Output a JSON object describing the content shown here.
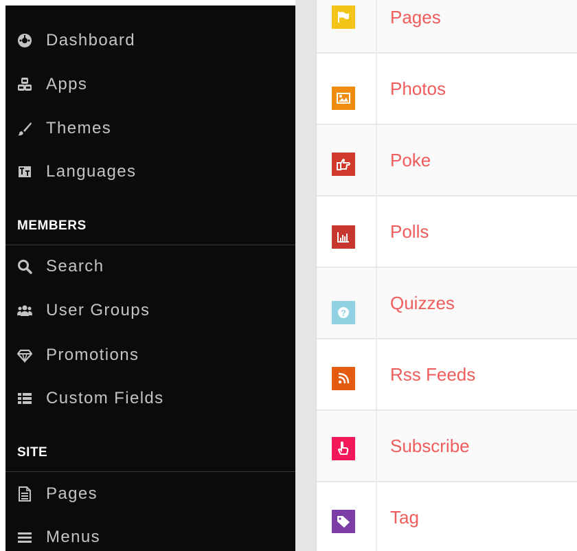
{
  "sidebar": {
    "items_top": [
      {
        "label": "Dashboard",
        "icon": "dashboard-icon"
      },
      {
        "label": "Apps",
        "icon": "apps-icon"
      },
      {
        "label": "Themes",
        "icon": "brush-icon"
      },
      {
        "label": "Languages",
        "icon": "language-icon"
      }
    ],
    "members_header": "MEMBERS",
    "members_items": [
      {
        "label": "Search",
        "icon": "search-icon"
      },
      {
        "label": "User Groups",
        "icon": "users-icon"
      },
      {
        "label": "Promotions",
        "icon": "diamond-icon"
      },
      {
        "label": "Custom Fields",
        "icon": "list-icon"
      }
    ],
    "site_header": "SITE",
    "site_items": [
      {
        "label": "Pages",
        "icon": "file-icon"
      },
      {
        "label": "Menus",
        "icon": "menu-icon"
      }
    ]
  },
  "apps_list": [
    {
      "label": "Pages",
      "icon": "flag-icon",
      "color": "#f2c417"
    },
    {
      "label": "Photos",
      "icon": "image-icon",
      "color": "#f08c0f"
    },
    {
      "label": "Poke",
      "icon": "hand-point-icon",
      "color": "#d0392b"
    },
    {
      "label": "Polls",
      "icon": "bar-chart-icon",
      "color": "#c8372f"
    },
    {
      "label": "Quizzes",
      "icon": "question-icon",
      "color": "#8fd3e3"
    },
    {
      "label": "Rss Feeds",
      "icon": "rss-icon",
      "color": "#e45c10"
    },
    {
      "label": "Subscribe",
      "icon": "hand-pointer-icon",
      "color": "#f2185a"
    },
    {
      "label": "Tag",
      "icon": "tag-icon",
      "color": "#7c3ea6"
    }
  ],
  "colors": {
    "sidebar_bg": "#0b0b0b",
    "link_red": "#f05c5c",
    "gutter": "#e5e5e5"
  }
}
